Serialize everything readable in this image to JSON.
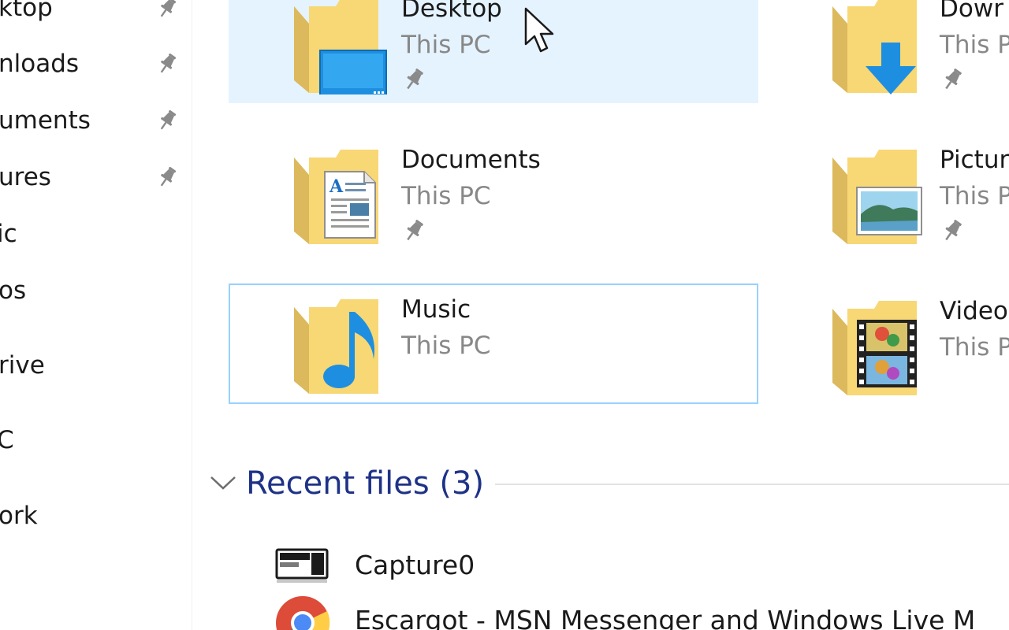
{
  "nav_pane": {
    "items": [
      {
        "label": "ktop",
        "pinned": true
      },
      {
        "label": "nloads",
        "pinned": true
      },
      {
        "label": "uments",
        "pinned": true
      },
      {
        "label": "ures",
        "pinned": true
      },
      {
        "label": "ic",
        "pinned": false
      },
      {
        "label": "os",
        "pinned": false
      },
      {
        "label": "rive",
        "pinned": false
      },
      {
        "label": "C",
        "pinned": false
      },
      {
        "label": "ork",
        "pinned": false
      }
    ]
  },
  "quick_access": {
    "tiles": [
      {
        "name": "Desktop",
        "location": "This PC",
        "pinned": true,
        "state": "hover",
        "icon": "desktop-folder-icon"
      },
      {
        "name": "Dowr",
        "location": "This PC",
        "pinned": true,
        "state": "normal",
        "icon": "downloads-folder-icon"
      },
      {
        "name": "Documents",
        "location": "This PC",
        "pinned": true,
        "state": "normal",
        "icon": "documents-folder-icon"
      },
      {
        "name": "Pictur",
        "location": "This P",
        "pinned": true,
        "state": "normal",
        "icon": "pictures-folder-icon"
      },
      {
        "name": "Music",
        "location": "This PC",
        "pinned": false,
        "state": "focused",
        "icon": "music-folder-icon"
      },
      {
        "name": "Video",
        "location": "This P",
        "pinned": false,
        "state": "normal",
        "icon": "videos-folder-icon"
      }
    ]
  },
  "recent_files": {
    "title": "Recent files (3)",
    "items": [
      {
        "name": "Capture0",
        "icon": "image-file-icon"
      },
      {
        "name": "Escargot - MSN Messenger and Windows Live M",
        "icon": "chrome-icon"
      }
    ]
  },
  "colors": {
    "hover_bg": "#e5f3ff",
    "focus_border": "#99d1ff",
    "section_header": "#1e3287",
    "secondary_text": "#888888",
    "folder_yellow": "#f8d775",
    "accent_blue": "#1e8fe0"
  }
}
